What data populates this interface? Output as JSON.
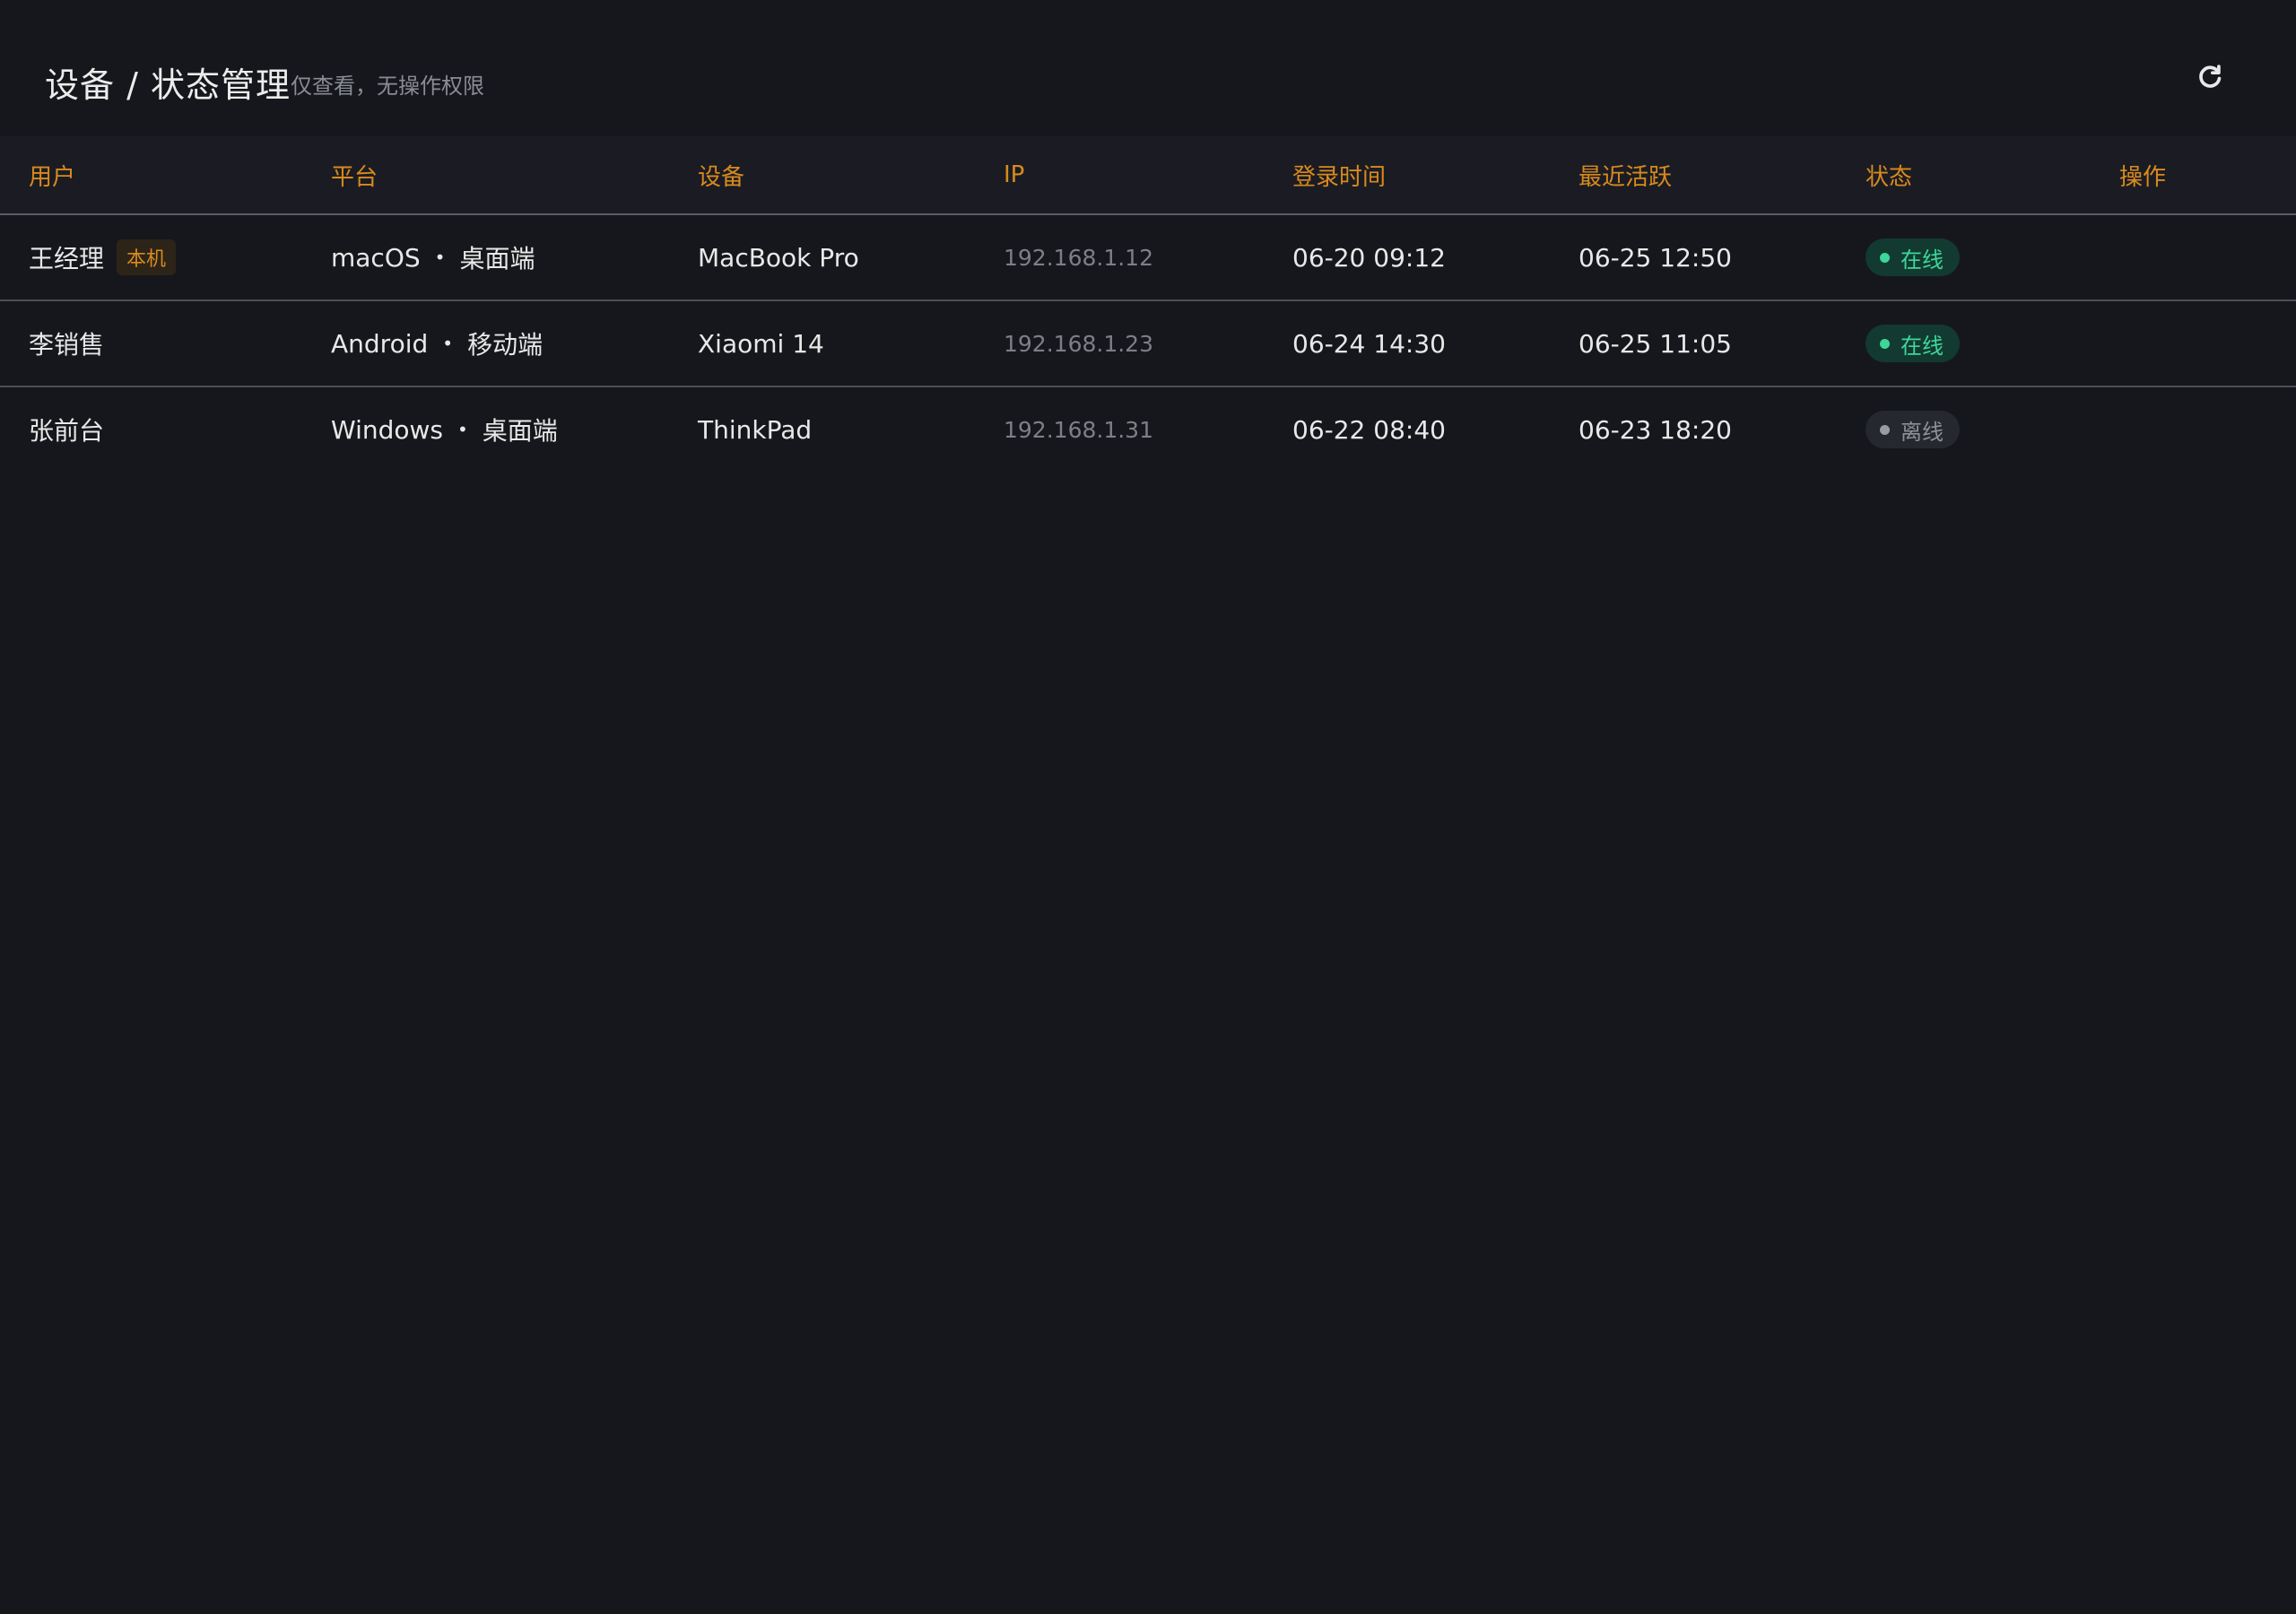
{
  "header": {
    "title": "设备 / 状态管理",
    "subtitle": "仅查看，无操作权限",
    "refresh_icon": "refresh-icon"
  },
  "table": {
    "columns": [
      "用户",
      "平台",
      "设备",
      "IP",
      "登录时间",
      "最近活跃",
      "状态",
      "操作"
    ],
    "rows": [
      {
        "user": "王经理",
        "tag": "本机",
        "os": "macOS",
        "client": "桌面端",
        "device": "MacBook Pro",
        "ip": "192.168.1.12",
        "login": "06-20 09:12",
        "active": "06-25 12:50",
        "status": "在线",
        "status_type": "online"
      },
      {
        "user": "李销售",
        "os": "Android",
        "client": "移动端",
        "device": "Xiaomi 14",
        "ip": "192.168.1.23",
        "login": "06-24 14:30",
        "active": "06-25 11:05",
        "status": "在线",
        "status_type": "online"
      },
      {
        "user": "张前台",
        "os": "Windows",
        "client": "桌面端",
        "device": "ThinkPad",
        "ip": "192.168.1.31",
        "login": "06-22 08:40",
        "active": "06-23 18:20",
        "status": "离线",
        "status_type": "offline"
      }
    ]
  },
  "colors": {
    "background": "#16171c",
    "header_row": "#1b1c23",
    "accent": "#d88a1e",
    "online": "#3ed69a",
    "offline": "#8d9099"
  }
}
